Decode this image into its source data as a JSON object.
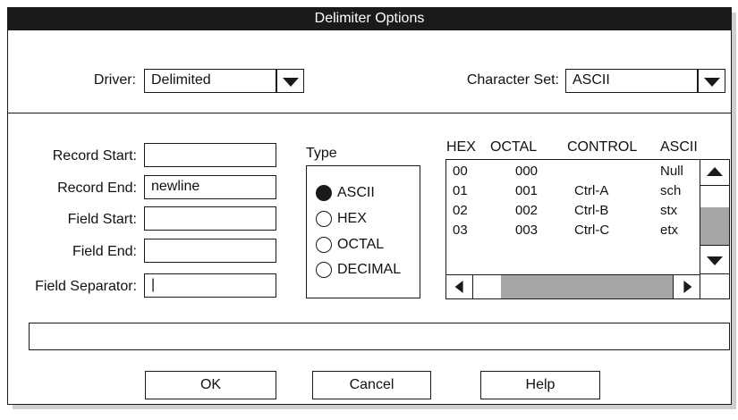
{
  "window": {
    "title": "Delimiter Options"
  },
  "driver": {
    "label": "Driver:",
    "value": "Delimited"
  },
  "charset": {
    "label": "Character Set:",
    "value": "ASCII"
  },
  "fields": {
    "record_start": {
      "label": "Record Start:",
      "value": ""
    },
    "record_end": {
      "label": "Record End:",
      "value": "newline"
    },
    "field_start": {
      "label": "Field Start:",
      "value": ""
    },
    "field_end": {
      "label": "Field End:",
      "value": ""
    },
    "field_separator": {
      "label": "Field Separator:",
      "value": "|"
    }
  },
  "type_group": {
    "label": "Type",
    "options": [
      "ASCII",
      "HEX",
      "OCTAL",
      "DECIMAL"
    ],
    "selected": "ASCII"
  },
  "table": {
    "columns": [
      "HEX",
      "OCTAL",
      "CONTROL",
      "ASCII"
    ],
    "rows": [
      [
        "00",
        "000",
        "",
        "Null"
      ],
      [
        "01",
        "001",
        "Ctrl-A",
        "sch"
      ],
      [
        "02",
        "002",
        "Ctrl-B",
        "stx"
      ],
      [
        "03",
        "003",
        "Ctrl-C",
        "etx"
      ]
    ]
  },
  "status": {
    "text": ""
  },
  "buttons": {
    "ok": "OK",
    "cancel": "Cancel",
    "help": "Help"
  }
}
